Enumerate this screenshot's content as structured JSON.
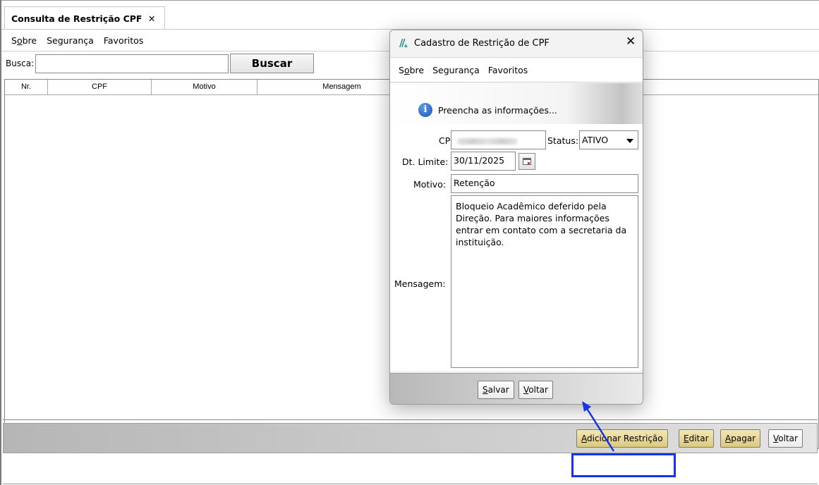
{
  "tab": {
    "title": "Consulta de Restrição CPF",
    "close_glyph": "✕"
  },
  "menu": {
    "items": [
      {
        "pre": "S",
        "mnemonic": "o",
        "post": "bre"
      },
      {
        "pre": "",
        "mnemonic": "",
        "post": "Segurança"
      },
      {
        "pre": "",
        "mnemonic": "",
        "post": "Favoritos"
      }
    ]
  },
  "search": {
    "label": "Busca:",
    "value": "",
    "button_label": "Buscar"
  },
  "table": {
    "columns": [
      "Nr.",
      "CPF",
      "Motivo",
      "Mensagem"
    ]
  },
  "footer_buttons": [
    {
      "pre": "",
      "mnemonic": "A",
      "post": "dicionar Restrição"
    },
    {
      "pre": "",
      "mnemonic": "E",
      "post": "ditar"
    },
    {
      "pre": "",
      "mnemonic": "A",
      "post": "pagar"
    },
    {
      "pre": "",
      "mnemonic": "V",
      "post": "oltar"
    }
  ],
  "dialog": {
    "title": "Cadastro de Restrição de CPF",
    "close_glyph": "✕",
    "menu": [
      {
        "pre": "S",
        "mnemonic": "o",
        "post": "bre"
      },
      {
        "pre": "",
        "mnemonic": "",
        "post": "Segurança"
      },
      {
        "pre": "",
        "mnemonic": "",
        "post": "Favoritos"
      }
    ],
    "info_glyph": "i",
    "info_text": "Preencha as informações...",
    "form": {
      "cpf_label": "CPF:",
      "status_label": "Status:",
      "status_value": "ATIVO",
      "dt_limite_label": "Dt. Limite:",
      "dt_limite_value": "30/11/2025",
      "motivo_label": "Motivo:",
      "motivo_value": "Retenção",
      "mensagem_label": "Mensagem:",
      "mensagem_value": "Bloqueio Acadêmico deferido pela Direção. Para maiores informações entrar em contato com a secretaria da instituição."
    },
    "buttons": [
      {
        "pre": "",
        "mnemonic": "S",
        "post": "alvar"
      },
      {
        "pre": "",
        "mnemonic": "V",
        "post": "oltar"
      }
    ]
  },
  "colors": {
    "highlight": "#1633e6",
    "arrow": "#1633e6",
    "primary_button": "#ddc97e",
    "info_icon": "#1a56b6"
  },
  "icons": {
    "app_logo": "app-logo-icon",
    "info": "info-icon",
    "calendar": "calendar-icon",
    "dropdown": "chevron-down-icon",
    "close": "close-icon"
  }
}
